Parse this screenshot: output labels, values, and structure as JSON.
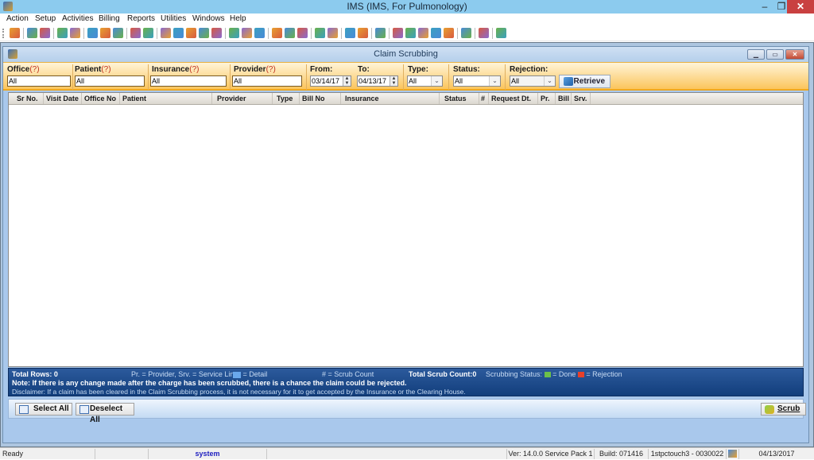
{
  "window": {
    "title": "IMS (IMS, For Pulmonology)",
    "min_label": "–",
    "max_label": "❐",
    "close_label": "✕"
  },
  "menu": [
    "Action",
    "Setup",
    "Activities",
    "Billing",
    "Reports",
    "Utilities",
    "Windows",
    "Help"
  ],
  "toolbar": {
    "icons": [
      "user-icon",
      "provider-icon",
      "provider-edit-icon",
      "patient-folder-icon",
      "patient-edit-icon",
      "clipboard-icon",
      "lab-flask-icon",
      "shield-icon",
      "document-icon",
      "notes-icon",
      "billing-icon",
      "payment-icon",
      "ledger-icon",
      "claims-icon",
      "eligibility-icon",
      "calendar-icon",
      "scheduler-icon",
      "chart-icon",
      "fax-icon",
      "scan-icon",
      "transfer-icon",
      "report-icon",
      "report-edit-icon",
      "bar-chart-icon",
      "user-folder-icon",
      "statement-icon",
      "import-icon",
      "export-icon",
      "word-icon",
      "edit-form-icon",
      "print-icon",
      "help-icon",
      "lock-icon",
      "exit-icon"
    ]
  },
  "child": {
    "title": "Claim Scrubbing",
    "min_label": "▁",
    "max_label": "▭",
    "close_label": "✕"
  },
  "filters": {
    "office": {
      "label": "Office",
      "hint": "(?)",
      "value": "All"
    },
    "patient": {
      "label": "Patient",
      "hint": "(?)",
      "value": "All"
    },
    "insurance": {
      "label": "Insurance",
      "hint": "(?)",
      "value": "All"
    },
    "provider": {
      "label": "Provider",
      "hint": "(?)",
      "value": "All"
    },
    "from": {
      "label": "From:",
      "value": "03/14/17"
    },
    "to": {
      "label": "To:",
      "value": "04/13/17"
    },
    "type": {
      "label": "Type:",
      "value": "All"
    },
    "status": {
      "label": "Status:",
      "value": "All"
    },
    "rejection": {
      "label": "Rejection:",
      "value": "All"
    },
    "retrieve_label": "Retrieve"
  },
  "grid": {
    "columns": [
      "Sr No.",
      "Visit Date",
      "Office No",
      "Patient",
      "Provider",
      "Type",
      "Bill No",
      "Insurance",
      "Status",
      "#",
      "Request Dt.",
      "Pr.",
      "Bill",
      "Srv."
    ],
    "rows": []
  },
  "info": {
    "total_rows": "Total Rows: 0",
    "legend_pr": "Pr. = Provider, Srv. = Service Line",
    "legend_detail": "= Detail",
    "legend_scrub_count": "# = Scrub Count",
    "total_scrub_count": "Total Scrub Count:0",
    "scrubbing_status_label": "Scrubbing Status:",
    "done_label": "= Done",
    "rejection_label": "= Rejection",
    "done_color": "#6cc04a",
    "rejection_color": "#e8402a",
    "note": "Note: If there is any change made after the charge has been scrubbed, there is a chance the claim could be rejected.",
    "disclaimer": "Disclaimer: If a claim has been cleared in the Claim Scrubbing process, it is not necessary for it to get accepted by the Insurance or the Clearing House."
  },
  "buttons": {
    "select_all": "Select All",
    "deselect_all": "Deselect All",
    "scrub": "Scrub"
  },
  "status": {
    "ready": "Ready",
    "user": "system",
    "version": "Ver: 14.0.0 Service Pack 1",
    "build": "Build: 071416",
    "station": "1stpctouch3 - 0030022",
    "date": "04/13/2017"
  }
}
